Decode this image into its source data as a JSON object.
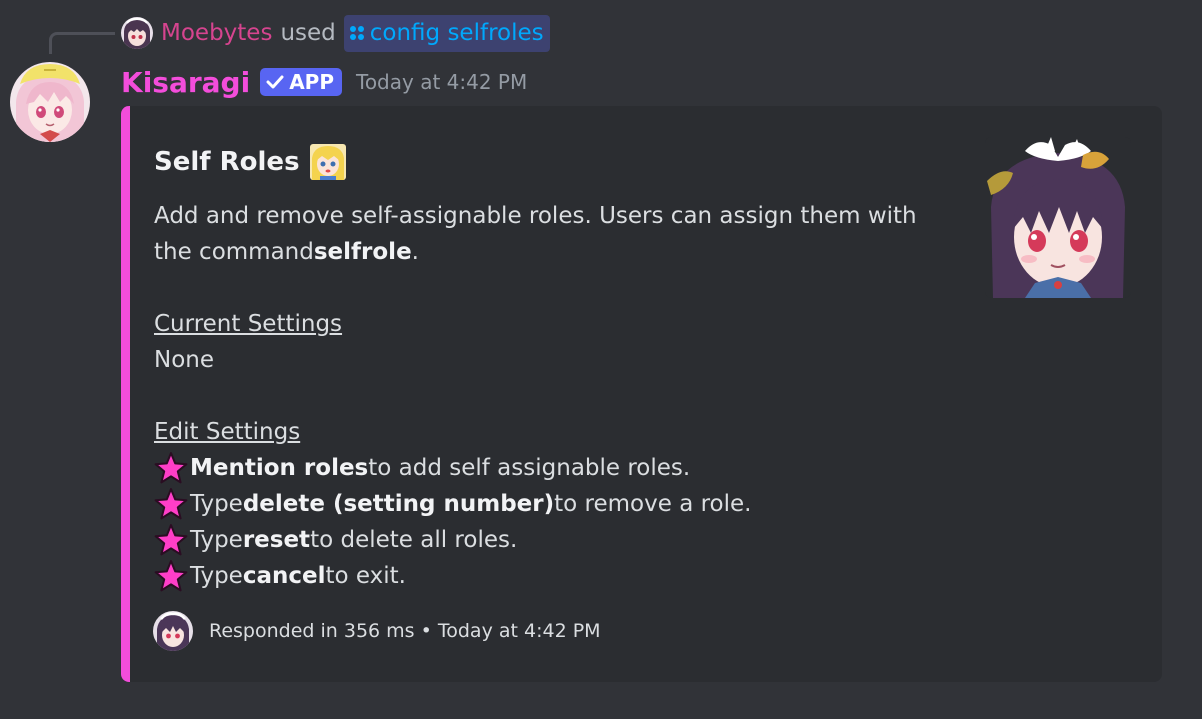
{
  "reply": {
    "username": "Moebytes",
    "verb": "used",
    "command": "config selfroles",
    "command_icon": "slash-command-icon",
    "avatar_icon": "moebytes-avatar"
  },
  "message": {
    "author": "Kisaragi",
    "badge": "APP",
    "badge_icon": "checkmark-icon",
    "timestamp": "Today at 4:42 PM",
    "author_color": "#f34ddb",
    "avatar_icon": "kisaragi-avatar"
  },
  "embed": {
    "accent_color": "#f34ddb",
    "title": "Self Roles",
    "title_emoji": "blonde-anime-girl-emoji",
    "description": {
      "line1": "Add and remove self-assignable roles. Users can assign them with",
      "line2_pre": "the command ",
      "line2_bold": "selfrole",
      "line2_post": "."
    },
    "current_heading": "Current Settings",
    "current_value": "None",
    "edit_heading": "Edit Settings",
    "edit_items": [
      {
        "pre": "",
        "bold": "Mention roles",
        "post": " to add self assignable roles."
      },
      {
        "pre": "Type ",
        "bold": "delete (setting number)",
        "post": " to remove a role."
      },
      {
        "pre": "Type ",
        "bold": "reset",
        "post": " to delete all roles."
      },
      {
        "pre": "Type ",
        "bold": "cancel",
        "post": " to exit."
      }
    ],
    "bullet_icon": "pink-star-icon",
    "thumbnail": "anime-girl-thumbnail",
    "footer_text": "Responded in 356 ms • Today at 4:42 PM",
    "footer_icon": "footer-avatar-icon"
  }
}
